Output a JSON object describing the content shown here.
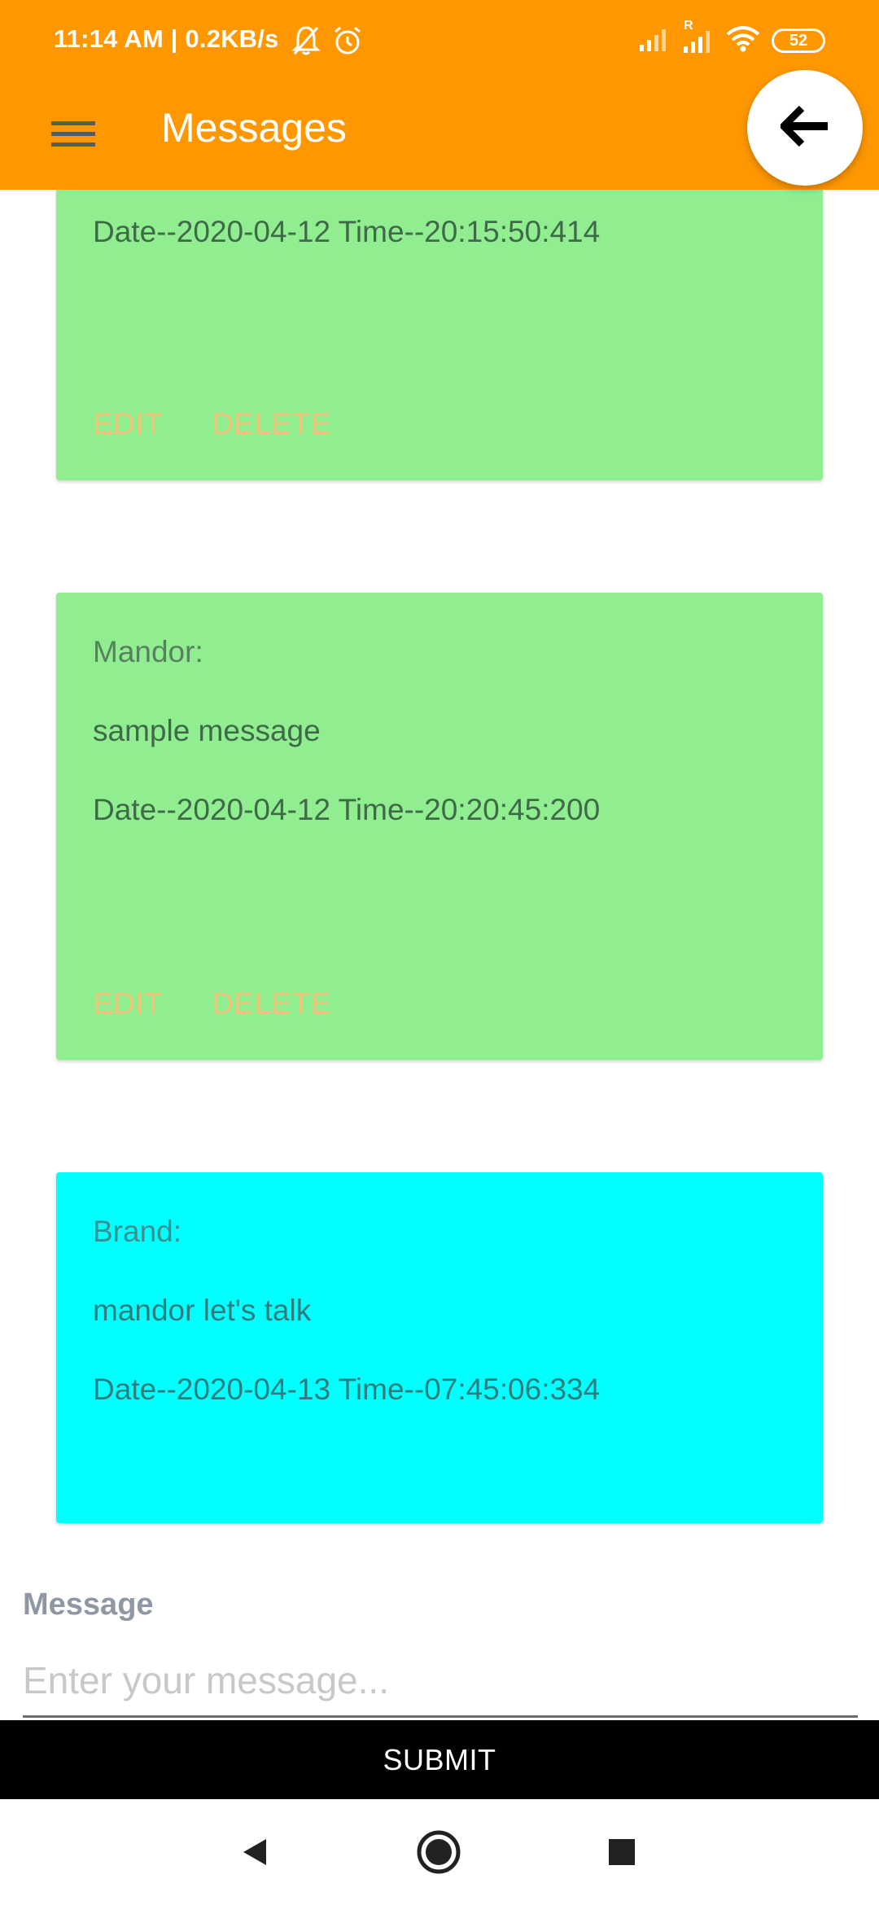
{
  "status_bar": {
    "time": "11:14 AM | 0.2KB/s",
    "battery": "52",
    "icons": [
      "bell-off-icon",
      "alarm-icon",
      "signal-icon",
      "signal-roaming-icon",
      "wifi-icon",
      "battery-icon"
    ],
    "roaming_mark": "R"
  },
  "app_bar": {
    "title": "Messages",
    "menu_icon": "hamburger-menu-icon",
    "back_icon": "arrow-back-icon",
    "color": "#FF9800"
  },
  "messages": [
    {
      "sender": "",
      "body": "",
      "datetime": "Date--2020-04-12  Time--20:15:50:414",
      "edit_label": "EDIT",
      "delete_label": "DELETE",
      "color": "#90EE90"
    },
    {
      "sender": "Mandor:",
      "body": "sample message",
      "datetime": "Date--2020-04-12  Time--20:20:45:200",
      "edit_label": "EDIT",
      "delete_label": "DELETE",
      "color": "#90EE90"
    },
    {
      "sender": "Brand:",
      "body": "mandor let's talk",
      "datetime": "Date--2020-04-13  Time--07:45:06:334",
      "color": "#00FFFF"
    }
  ],
  "composer": {
    "label": "Message",
    "placeholder": "Enter your message...",
    "value": "",
    "submit_label": "SUBMIT"
  },
  "nav_bar": {
    "icons": [
      "back-triangle-icon",
      "home-circle-icon",
      "recents-square-icon"
    ]
  }
}
